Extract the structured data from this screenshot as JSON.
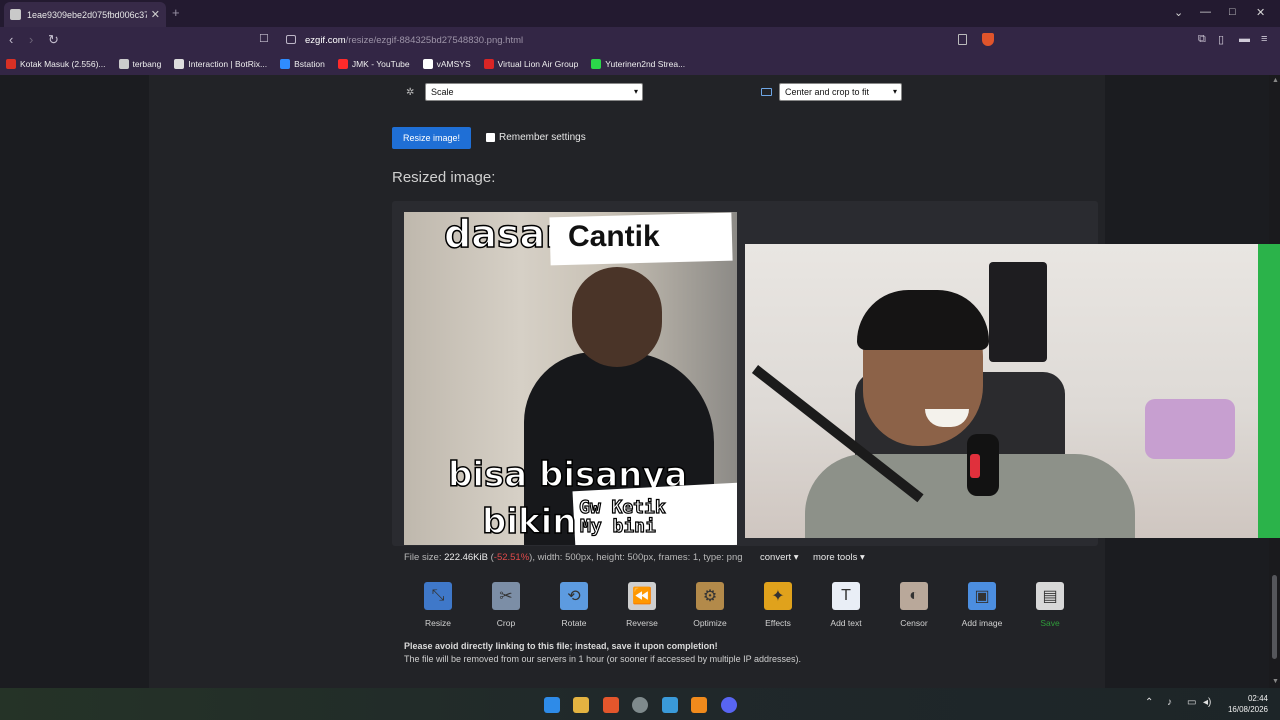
{
  "browser": {
    "tab_title": "1eae9309ebe2d075fbd006c376d...",
    "url_host": "ezgif.com",
    "url_path": "/resize/ezgif-884325bd27548830.png.html",
    "bookmarks": [
      {
        "label": "Kotak Masuk (2.556)...",
        "color": "#d93025"
      },
      {
        "label": "terbang",
        "color": "#cccccc"
      },
      {
        "label": "Interaction | BotRix...",
        "color": "#dddddd"
      },
      {
        "label": "Bstation",
        "color": "#2f8cff"
      },
      {
        "label": "JMK - YouTube",
        "color": "#ff2a2a"
      },
      {
        "label": "vAMSYS",
        "color": "#ffffff"
      },
      {
        "label": "Virtual Lion Air Group",
        "color": "#d92525"
      },
      {
        "label": "Yuterinen2nd Strea...",
        "color": "#2bd84a"
      }
    ]
  },
  "form": {
    "resize_method_select": "Scale",
    "aspect_select": "Center and crop to fit",
    "submit_label": "Resize image!",
    "remember_label": "Remember settings"
  },
  "result": {
    "heading": "Resized image:",
    "caption_top_left": "dasar",
    "caption_top_right": "Cantik",
    "caption_bottom_1": "bisa bisanya",
    "caption_bottom_2": "bikin",
    "sticker_line_1": "Gw Ketik",
    "sticker_line_2": "My bini",
    "file_size_label": "File size: ",
    "file_size_value": "222.46KiB",
    "file_size_change": "-52.51%",
    "file_meta": "), width: 500px, height: 500px, frames: 1, type: png",
    "convert_label": "convert",
    "more_tools_label": "more tools"
  },
  "tools": [
    {
      "label": "Resize",
      "icon": "resize-icon",
      "color": "#3f78c9"
    },
    {
      "label": "Crop",
      "icon": "crop-icon",
      "color": "#7c8ea6"
    },
    {
      "label": "Rotate",
      "icon": "rotate-icon",
      "color": "#5d9be0"
    },
    {
      "label": "Reverse",
      "icon": "reverse-icon",
      "color": "#cfcfcf"
    },
    {
      "label": "Optimize",
      "icon": "optimize-icon",
      "color": "#b38a4a"
    },
    {
      "label": "Effects",
      "icon": "effects-icon",
      "color": "#e0a21c"
    },
    {
      "label": "Add text",
      "icon": "add-text-icon",
      "color": "#e9eef6"
    },
    {
      "label": "Censor",
      "icon": "censor-icon",
      "color": "#b9a89a"
    },
    {
      "label": "Add image",
      "icon": "add-image-icon",
      "color": "#4c8ee0"
    },
    {
      "label": "Save",
      "icon": "save-icon",
      "color": "#d8d8d8"
    }
  ],
  "notice": {
    "line1": "Please avoid directly linking to this file; instead, save it upon completion!",
    "line2": "The file will be removed from our servers in 1 hour (or sooner if accessed by multiple IP addresses)."
  },
  "taskbar": {
    "time": "02:44",
    "date": "16/08/2026"
  }
}
